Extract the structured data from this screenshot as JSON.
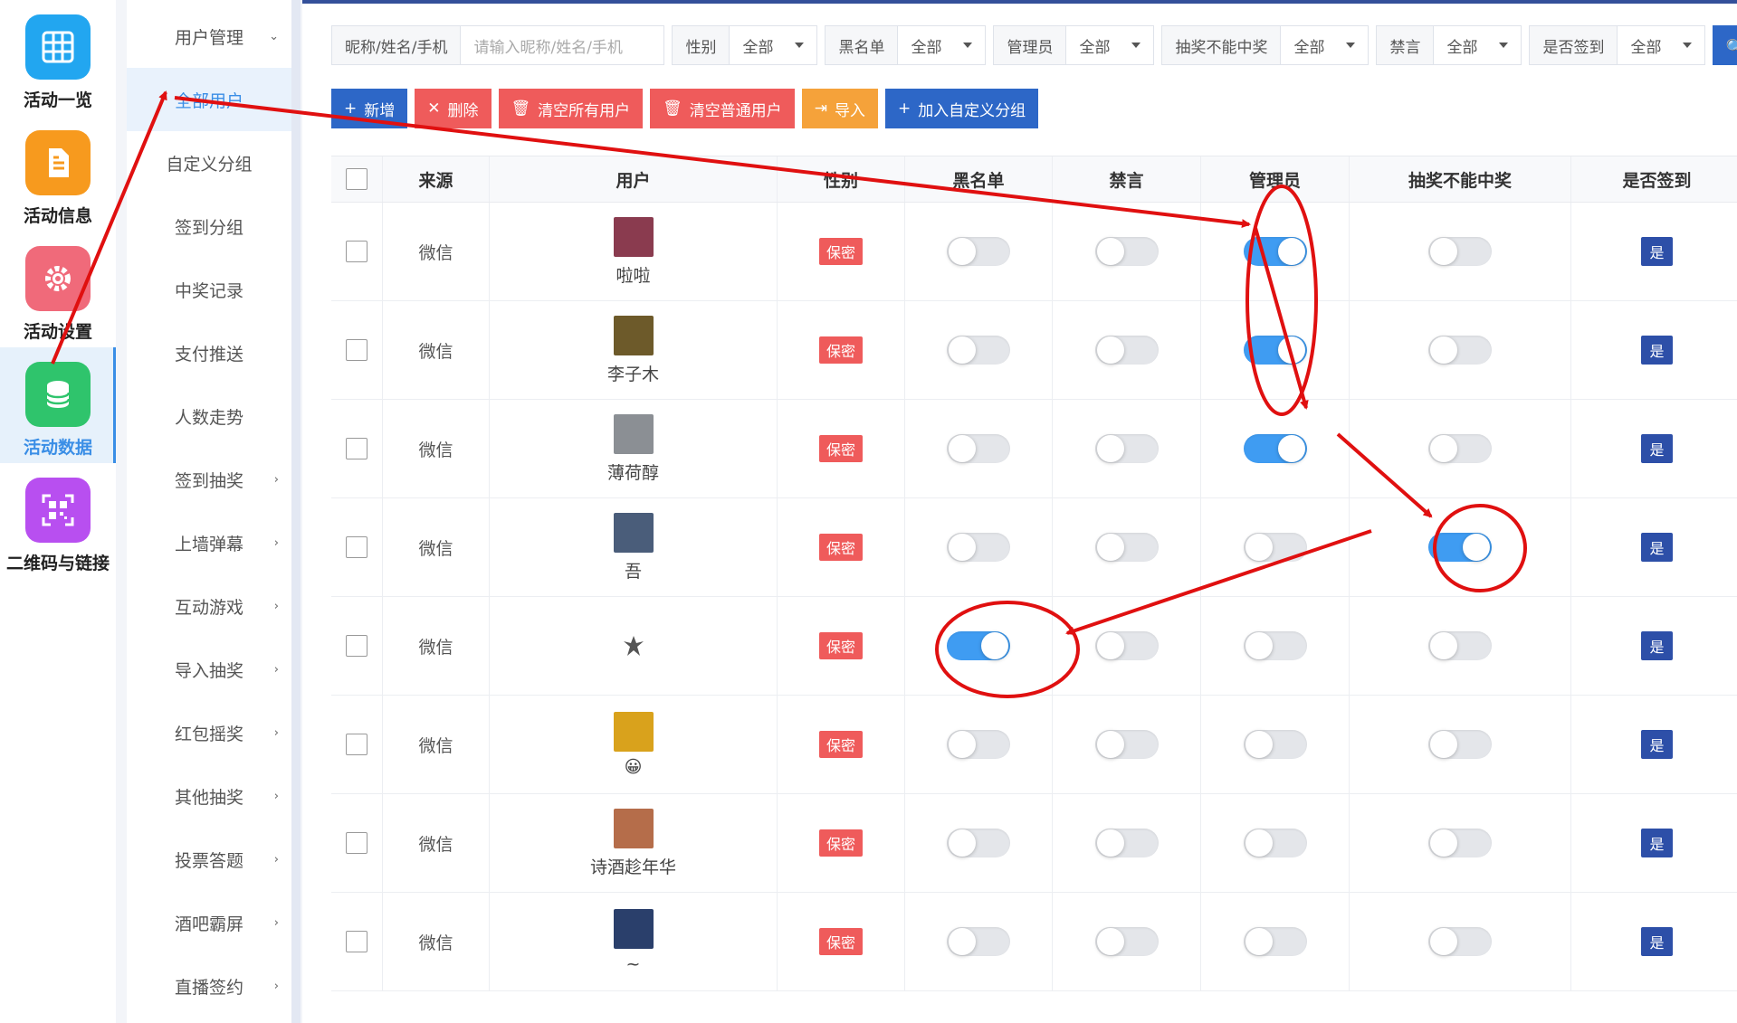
{
  "rail": [
    {
      "label": "活动一览",
      "icon": "grid-icon",
      "color": "#22a6f0"
    },
    {
      "label": "活动信息",
      "icon": "document-icon",
      "color": "#f79a1e"
    },
    {
      "label": "活动设置",
      "icon": "gear-icon",
      "color": "#f06a7a"
    },
    {
      "label": "活动数据",
      "icon": "database-icon",
      "color": "#2fc46c"
    },
    {
      "label": "二维码与链接",
      "icon": "qrcode-icon",
      "color": "#b84ff0"
    }
  ],
  "submenu": [
    {
      "label": "用户管理",
      "chevron": "⌄"
    },
    {
      "label": "全部用户",
      "chevron": ""
    },
    {
      "label": "自定义分组",
      "chevron": ""
    },
    {
      "label": "签到分组",
      "chevron": ""
    },
    {
      "label": "中奖记录",
      "chevron": ""
    },
    {
      "label": "支付推送",
      "chevron": ""
    },
    {
      "label": "人数走势",
      "chevron": ""
    },
    {
      "label": "签到抽奖",
      "chevron": "›"
    },
    {
      "label": "上墙弹幕",
      "chevron": "›"
    },
    {
      "label": "互动游戏",
      "chevron": "›"
    },
    {
      "label": "导入抽奖",
      "chevron": "›"
    },
    {
      "label": "红包摇奖",
      "chevron": "›"
    },
    {
      "label": "其他抽奖",
      "chevron": "›"
    },
    {
      "label": "投票答题",
      "chevron": "›"
    },
    {
      "label": "酒吧霸屏",
      "chevron": "›"
    },
    {
      "label": "直播签约",
      "chevron": "›"
    }
  ],
  "filters": {
    "search_label": "昵称/姓名/手机",
    "search_placeholder": "请输入昵称/姓名/手机",
    "selects": [
      {
        "label": "性别",
        "value": "全部"
      },
      {
        "label": "黑名单",
        "value": "全部"
      },
      {
        "label": "管理员",
        "value": "全部"
      },
      {
        "label": "抽奖不能中奖",
        "value": "全部"
      },
      {
        "label": "禁言",
        "value": "全部"
      },
      {
        "label": "是否签到",
        "value": "全部"
      }
    ],
    "search_button": "🔍 搜"
  },
  "actions": [
    {
      "label": "新增",
      "icon": "+",
      "style": "btn-blue"
    },
    {
      "label": "删除",
      "icon": "✕",
      "style": "btn-red"
    },
    {
      "label": "清空所有用户",
      "icon": "🗑",
      "style": "btn-red"
    },
    {
      "label": "清空普通用户",
      "icon": "🗑",
      "style": "btn-red"
    },
    {
      "label": "导入",
      "icon": "⇥",
      "style": "btn-orange"
    },
    {
      "label": "加入自定义分组",
      "icon": "+",
      "style": "btn-blue"
    }
  ],
  "columns": [
    "",
    "来源",
    "用户",
    "性别",
    "黑名单",
    "禁言",
    "管理员",
    "抽奖不能中奖",
    "是否签到"
  ],
  "rows": [
    {
      "source": "微信",
      "name": "啦啦",
      "gender": "保密",
      "blacklist": false,
      "mute": false,
      "admin": true,
      "no_win": false,
      "signed": "是",
      "avatar_color": "#8a3b4f"
    },
    {
      "source": "微信",
      "name": "李子木",
      "gender": "保密",
      "blacklist": false,
      "mute": false,
      "admin": true,
      "no_win": false,
      "signed": "是",
      "avatar_color": "#6d5a2a"
    },
    {
      "source": "微信",
      "name": "薄荷醇",
      "gender": "保密",
      "blacklist": false,
      "mute": false,
      "admin": true,
      "no_win": false,
      "signed": "是",
      "avatar_color": "#8b8f94"
    },
    {
      "source": "微信",
      "name": "吾",
      "gender": "保密",
      "blacklist": false,
      "mute": false,
      "admin": false,
      "no_win": true,
      "signed": "是",
      "avatar_color": "#4a5d7a"
    },
    {
      "source": "微信",
      "name": "",
      "gender": "保密",
      "blacklist": true,
      "mute": false,
      "admin": false,
      "no_win": false,
      "signed": "是",
      "avatar_color": "#ffffff"
    },
    {
      "source": "微信",
      "name": "😀",
      "gender": "保密",
      "blacklist": false,
      "mute": false,
      "admin": false,
      "no_win": false,
      "signed": "是",
      "avatar_color": "#d9a21c"
    },
    {
      "source": "微信",
      "name": "诗酒趁年华",
      "gender": "保密",
      "blacklist": false,
      "mute": false,
      "admin": false,
      "no_win": false,
      "signed": "是",
      "avatar_color": "#b56d4a"
    },
    {
      "source": "微信",
      "name": "~",
      "gender": "保密",
      "blacklist": false,
      "mute": false,
      "admin": false,
      "no_win": false,
      "signed": "是",
      "avatar_color": "#2a3f6b"
    }
  ],
  "colors": {
    "primary": "#2d67c7",
    "danger": "#ef5b5b",
    "warning": "#f5a23a",
    "toggle_on": "#3f9cf2",
    "annotation": "#e01010"
  }
}
